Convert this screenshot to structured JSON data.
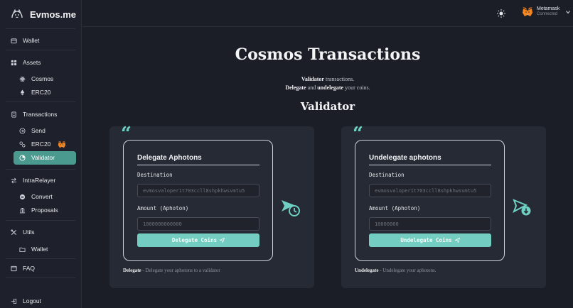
{
  "app": {
    "name": "Evmos.me"
  },
  "sidebar": {
    "wallet": "Wallet",
    "assets": "Assets",
    "cosmos": "Cosmos",
    "erc20": "ERC20",
    "transactions": "Transactions",
    "send": "Send",
    "erc20_tx": "ERC20",
    "validator": "Validator",
    "intrarelayer": "IntraRelayer",
    "convert": "Convert",
    "proposals": "Proposals",
    "utils": "Utils",
    "utils_wallet": "Wallet",
    "faq": "FAQ",
    "logout": "Logout"
  },
  "header": {
    "wallet_name": "Metamask",
    "wallet_status": "Connected"
  },
  "page": {
    "title": "Cosmos Transactions",
    "subtitle1_bold": "Validator",
    "subtitle1_rest": " transactions.",
    "subtitle2_bold1": "Delegate",
    "subtitle2_mid": " and ",
    "subtitle2_bold2": "undelegate",
    "subtitle2_rest": " your coins.",
    "section": "Validator"
  },
  "delegate": {
    "quote": "“",
    "title": "Delegate Aphotons",
    "destination_label": "Destination",
    "destination_placeholder": "evmosvaloper1t703ccll8shpkhwsvmtu5",
    "amount_label": "Amount (Aphoton)",
    "amount_placeholder": "1000000000000",
    "button": "Delegate Coins",
    "note_bold": "Delegate",
    "note_rest": " - Delegate your aphotons to a validator"
  },
  "undelegate": {
    "quote": "“",
    "title": "Undelegate aphotons",
    "destination_label": "Destination",
    "destination_placeholder": "evmosvaloper1t703ccll8shpkhwsvmtu5",
    "amount_label": "Amount (Aphoton)",
    "amount_placeholder": "10000000",
    "button": "Undelegate Coins",
    "note_bold": "Undelegate",
    "note_rest": " - Undelegate your aphotons."
  },
  "colors": {
    "accent": "#74cdc1",
    "active_nav": "#4b9a90",
    "background": "#1b1e27"
  }
}
